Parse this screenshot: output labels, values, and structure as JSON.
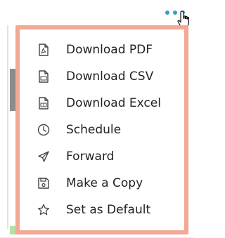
{
  "more_button": {
    "icon": "more-horizontal-icon",
    "color": "#3b9cc2"
  },
  "cursor": {
    "icon": "pointer-hand-cursor-icon"
  },
  "menu": {
    "border_color": "#f3a794",
    "items": [
      {
        "label": "Download PDF",
        "icon": "pdf-file-icon"
      },
      {
        "label": "Download CSV",
        "icon": "csv-file-icon"
      },
      {
        "label": "Download Excel",
        "icon": "excel-file-icon"
      },
      {
        "label": "Schedule",
        "icon": "clock-icon"
      },
      {
        "label": "Forward",
        "icon": "paper-plane-icon"
      },
      {
        "label": "Make a Copy",
        "icon": "floppy-disk-icon"
      },
      {
        "label": "Set as Default",
        "icon": "star-icon"
      }
    ]
  }
}
